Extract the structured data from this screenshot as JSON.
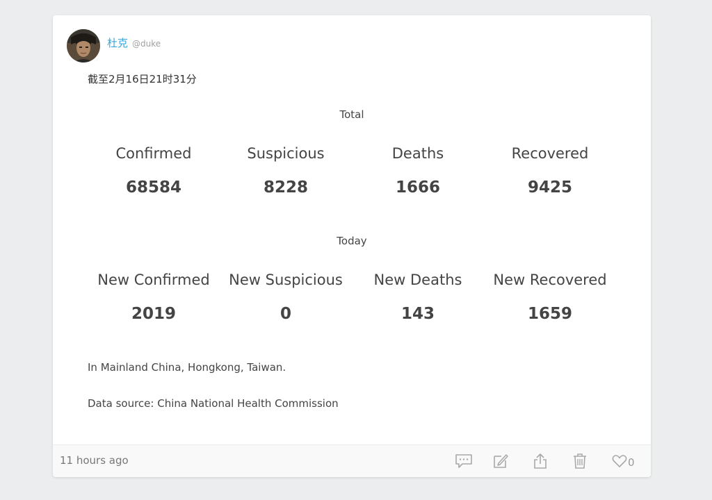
{
  "author": {
    "name": "杜克",
    "handle": "@duke"
  },
  "post": {
    "date_text": "截至2月16日21时31分",
    "total": {
      "title": "Total",
      "stats": [
        {
          "label": "Confirmed",
          "value": "68584"
        },
        {
          "label": "Suspicious",
          "value": "8228"
        },
        {
          "label": "Deaths",
          "value": "1666"
        },
        {
          "label": "Recovered",
          "value": "9425"
        }
      ]
    },
    "today": {
      "title": "Today",
      "stats": [
        {
          "label": "New Confirmed",
          "value": "2019"
        },
        {
          "label": "New Suspicious",
          "value": "0"
        },
        {
          "label": "New Deaths",
          "value": "143"
        },
        {
          "label": "New Recovered",
          "value": "1659"
        }
      ]
    },
    "region_note": "In Mainland China, Hongkong, Taiwan.",
    "source_note": "Data source: China National Health Commission"
  },
  "footer": {
    "time_ago": "11 hours ago",
    "like_count": "0",
    "icons": {
      "comment": "comment-icon",
      "edit": "edit-icon",
      "share": "share-icon",
      "delete": "trash-icon",
      "like": "heart-icon"
    }
  },
  "colors": {
    "background": "#ecedee",
    "card": "#ffffff",
    "author_link": "#3ba4d8",
    "text": "#444444",
    "icon": "#a8a8a8"
  }
}
